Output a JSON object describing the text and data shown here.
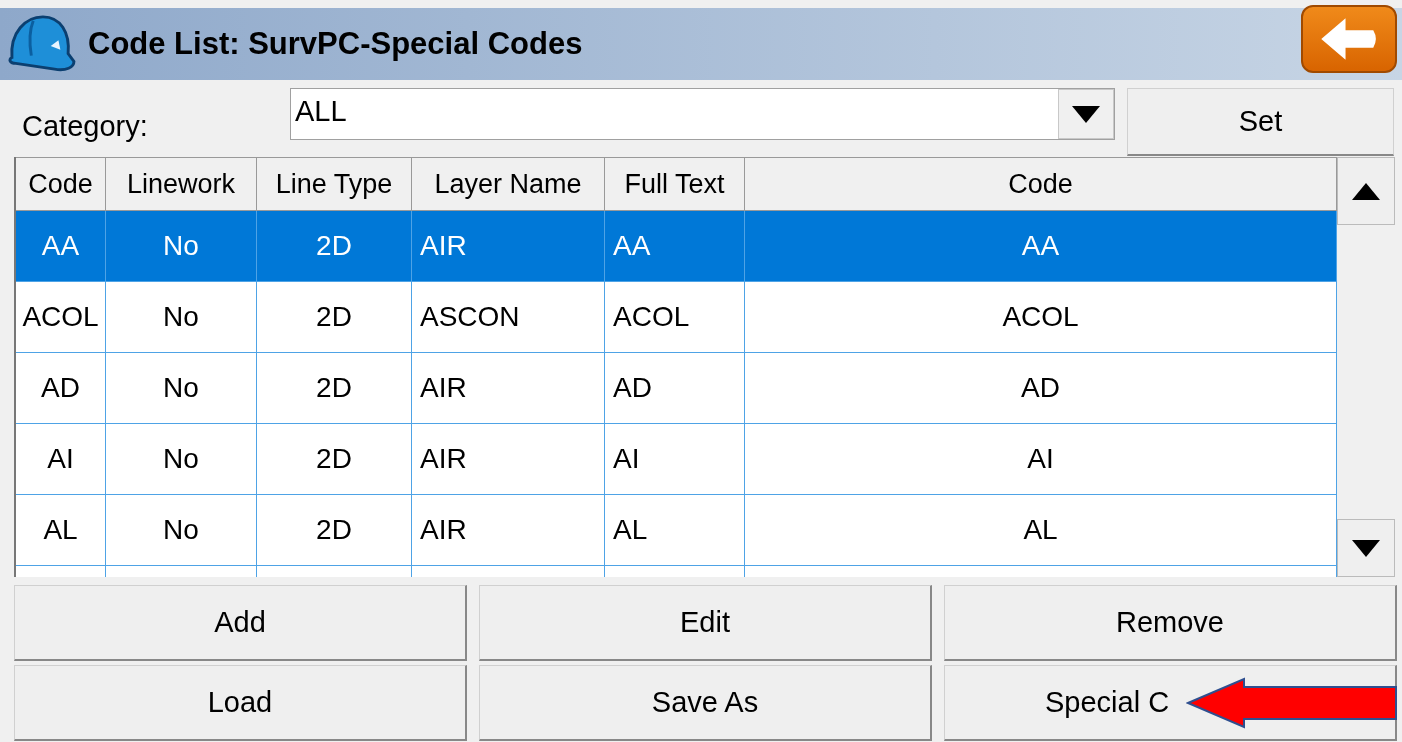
{
  "window": {
    "title": "Code List: SurvPC-Special Codes"
  },
  "category": {
    "label": "Category:",
    "value": "ALL",
    "set_button": "Set"
  },
  "table": {
    "columns": [
      "Code",
      "Linework",
      "Line Type",
      "Layer Name",
      "Full Text",
      "Code"
    ],
    "rows": [
      {
        "cells": [
          "AA",
          "No",
          "2D",
          "AIR",
          "AA",
          "AA"
        ],
        "selected": true
      },
      {
        "cells": [
          "ACOL",
          "No",
          "2D",
          "ASCON",
          "ACOL",
          "ACOL"
        ],
        "selected": false
      },
      {
        "cells": [
          "AD",
          "No",
          "2D",
          "AIR",
          "AD",
          "AD"
        ],
        "selected": false
      },
      {
        "cells": [
          "AI",
          "No",
          "2D",
          "AIR",
          "AI",
          "AI"
        ],
        "selected": false
      },
      {
        "cells": [
          "AL",
          "No",
          "2D",
          "AIR",
          "AL",
          "AL"
        ],
        "selected": false
      }
    ]
  },
  "buttons": [
    "Add",
    "Edit",
    "Remove",
    "Load",
    "Save As",
    "Special C"
  ]
}
